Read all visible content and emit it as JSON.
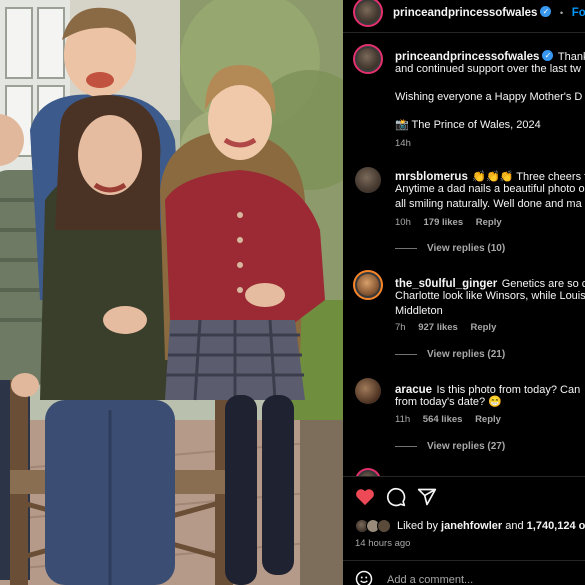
{
  "photo": {
    "description_icon": "family-photo"
  },
  "header": {
    "username": "princeandprincessofwales",
    "dot": "•",
    "follow_label": "Follo"
  },
  "caption": {
    "username": "princeandprincessofwales",
    "line1_rest": "Thank y",
    "line2": "and continued support over the last tw",
    "line3": "Wishing everyone a Happy Mother's D",
    "line4": "📸 The Prince of Wales, 2024",
    "time": "14h"
  },
  "comments": [
    {
      "username": "mrsblomerus",
      "line1": "👏👏👏 Three cheers for",
      "line2": "Anytime a dad nails a beautiful photo o",
      "line3": "all smiling naturally. Well done and ma",
      "time": "10h",
      "likes": "179 likes",
      "reply": "Reply",
      "view_replies": "View replies (10)"
    },
    {
      "username": "the_s0ulful_ginger",
      "line1": "Genetics are so c",
      "line2": "Charlotte look like Winsors, while Louis",
      "line3": "Middleton",
      "time": "7h",
      "likes": "927 likes",
      "reply": "Reply",
      "view_replies": "View replies (21)"
    },
    {
      "username": "aracue",
      "line1": "Is this photo from today? Can",
      "line2": "from today's date? 😁",
      "time": "11h",
      "likes": "564 likes",
      "reply": "Reply",
      "view_replies": "View replies (27)"
    }
  ],
  "actions": {
    "like_icon": "heart-icon",
    "comment_icon": "comment-icon",
    "share_icon": "share-icon",
    "liked_prefix": "Liked by",
    "liked_user": "janehfowler",
    "liked_and": "and",
    "liked_count": "1,740,124 o",
    "posted_time": "14 hours ago",
    "add_comment_placeholder": "Add a comment...",
    "heart_color": "#ed4956"
  }
}
